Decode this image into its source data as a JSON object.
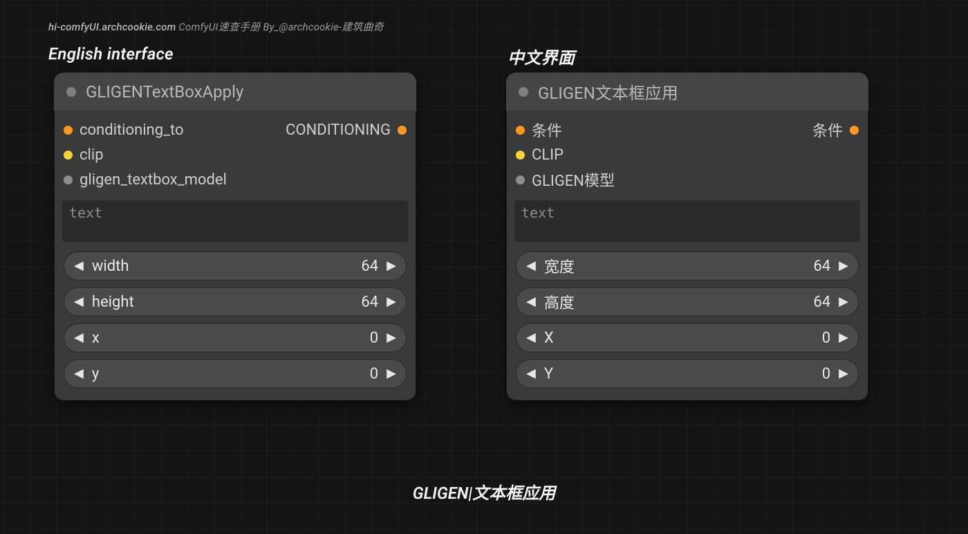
{
  "attribution": {
    "site": "hi-comfyUI.archcookie.com",
    "desc": "ComfyUI速查手册 By_@archcookie-建筑曲奇"
  },
  "labels": {
    "english": "English interface",
    "chinese": "中文界面"
  },
  "footer": "GLIGEN|文本框应用",
  "node_en": {
    "title": "GLIGENTextBoxApply",
    "inputs": [
      {
        "name": "conditioning_to",
        "color": "orange"
      },
      {
        "name": "clip",
        "color": "yellow"
      },
      {
        "name": "gligen_textbox_model",
        "color": "grey"
      }
    ],
    "outputs": [
      {
        "name": "CONDITIONING",
        "color": "orange"
      }
    ],
    "text_placeholder": "text",
    "widgets": [
      {
        "name": "width",
        "value": "64"
      },
      {
        "name": "height",
        "value": "64"
      },
      {
        "name": "x",
        "value": "0"
      },
      {
        "name": "y",
        "value": "0"
      }
    ]
  },
  "node_zh": {
    "title": "GLIGEN文本框应用",
    "inputs": [
      {
        "name": "条件",
        "color": "orange"
      },
      {
        "name": "CLIP",
        "color": "yellow"
      },
      {
        "name": "GLIGEN模型",
        "color": "grey"
      }
    ],
    "outputs": [
      {
        "name": "条件",
        "color": "orange"
      }
    ],
    "text_placeholder": "text",
    "widgets": [
      {
        "name": "宽度",
        "value": "64"
      },
      {
        "name": "高度",
        "value": "64"
      },
      {
        "name": "X",
        "value": "0"
      },
      {
        "name": "Y",
        "value": "0"
      }
    ]
  }
}
